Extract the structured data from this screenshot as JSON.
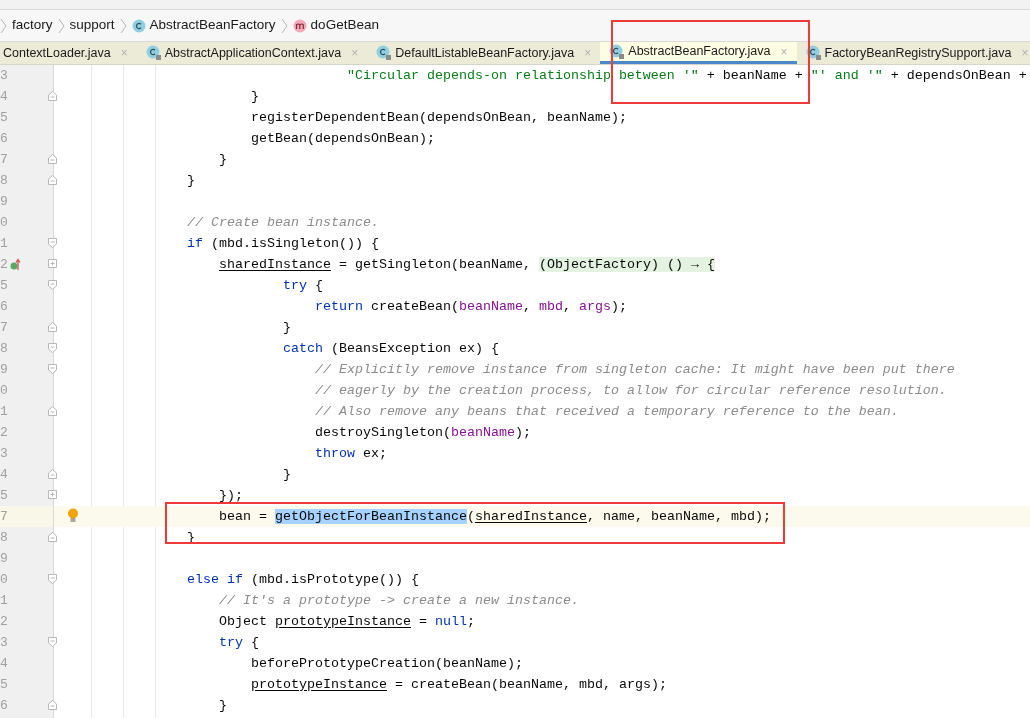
{
  "breadcrumbs": [
    {
      "label": "factory",
      "kind": "package"
    },
    {
      "label": "support",
      "kind": "package"
    },
    {
      "label": "AbstractBeanFactory",
      "kind": "class"
    },
    {
      "label": "doGetBean",
      "kind": "method"
    }
  ],
  "tabs": [
    {
      "label": "ContextLoader.java",
      "close": "×",
      "icon": false,
      "selected": false,
      "annotated": false
    },
    {
      "label": "AbstractApplicationContext.java",
      "close": "×",
      "icon": true,
      "selected": false,
      "annotated": false
    },
    {
      "label": "DefaultListableBeanFactory.java",
      "close": "×",
      "icon": true,
      "selected": false,
      "annotated": false
    },
    {
      "label": "AbstractBeanFactory.java",
      "close": "×",
      "icon": true,
      "selected": true,
      "annotated": true
    },
    {
      "label": "FactoryBeanRegistrySupport.java",
      "close": "×",
      "icon": true,
      "selected": false,
      "annotated": false
    }
  ],
  "editor": {
    "lines": [
      {
        "number": "3",
        "kind": "plain",
        "segments": [
          {
            "text": "                                    \"Circular depends-on relationship between '\"",
            "kind": "string"
          },
          {
            "text": " + beanName + ",
            "kind": "plain"
          },
          {
            "text": "\"' and '\"",
            "kind": "string"
          },
          {
            "text": " + dependsOnBean +",
            "kind": "plain"
          }
        ]
      },
      {
        "number": "4",
        "kind": "fold_end",
        "segments": [
          {
            "text": "                        }",
            "kind": "plain"
          }
        ]
      },
      {
        "number": "5",
        "kind": "plain",
        "segments": [
          {
            "text": "                        registerDependentBean(dependsOnBean, beanName);",
            "kind": "plain"
          }
        ]
      },
      {
        "number": "6",
        "kind": "plain",
        "segments": [
          {
            "text": "                        getBean(dependsOnBean);",
            "kind": "plain"
          }
        ]
      },
      {
        "number": "7",
        "kind": "fold_end",
        "segments": [
          {
            "text": "                    }",
            "kind": "plain"
          }
        ]
      },
      {
        "number": "8",
        "kind": "fold_end",
        "segments": [
          {
            "text": "                }",
            "kind": "plain"
          }
        ]
      },
      {
        "number": "9",
        "kind": "plain"
      },
      {
        "number": "0",
        "kind": "plain",
        "segments": [
          {
            "text": "                // Create bean instance.",
            "kind": "comment"
          }
        ]
      },
      {
        "number": "1",
        "kind": "fold_start",
        "segments": [
          {
            "text": "                if",
            "kind": "keyword"
          },
          {
            "text": " (mbd.isSingleton()) {",
            "kind": "plain"
          }
        ]
      },
      {
        "number": "2",
        "kind": "collapsed",
        "marker": true,
        "segments": [
          {
            "text": "                    sharedInstance",
            "kind": "field"
          },
          {
            "text": " = getSingleton(beanName, ",
            "kind": "plain"
          },
          {
            "text": "(ObjectFactory) () → {",
            "kind": "folded"
          }
        ]
      },
      {
        "number": "5",
        "kind": "fold_start",
        "segments": [
          {
            "text": "                            try",
            "kind": "keyword"
          },
          {
            "text": " {",
            "kind": "plain"
          }
        ]
      },
      {
        "number": "6",
        "kind": "plain",
        "segments": [
          {
            "text": "                                return",
            "kind": "keyword"
          },
          {
            "text": " createBean(",
            "kind": "plain"
          },
          {
            "text": "beanName",
            "kind": "param"
          },
          {
            "text": ", ",
            "kind": "plain"
          },
          {
            "text": "mbd",
            "kind": "param"
          },
          {
            "text": ", ",
            "kind": "plain"
          },
          {
            "text": "args",
            "kind": "param"
          },
          {
            "text": ");",
            "kind": "plain"
          }
        ]
      },
      {
        "number": "7",
        "kind": "fold_end",
        "segments": [
          {
            "text": "                            }",
            "kind": "plain"
          }
        ]
      },
      {
        "number": "8",
        "kind": "fold_start",
        "segments": [
          {
            "text": "                            catch",
            "kind": "keyword"
          },
          {
            "text": " (BeansException ex) {",
            "kind": "plain"
          }
        ]
      },
      {
        "number": "9",
        "kind": "fold_start",
        "segments": [
          {
            "text": "                                // Explicitly remove instance from singleton cache: It might have been put there",
            "kind": "comment"
          }
        ]
      },
      {
        "number": "0",
        "kind": "plain",
        "segments": [
          {
            "text": "                                // eagerly by the creation process, to allow for circular reference resolution.",
            "kind": "comment"
          }
        ]
      },
      {
        "number": "1",
        "kind": "fold_end",
        "segments": [
          {
            "text": "                                // Also remove any beans that received a temporary reference to the bean.",
            "kind": "comment"
          }
        ]
      },
      {
        "number": "2",
        "kind": "plain",
        "segments": [
          {
            "text": "                                destroySingleton(",
            "kind": "plain"
          },
          {
            "text": "beanName",
            "kind": "param"
          },
          {
            "text": ");",
            "kind": "plain"
          }
        ]
      },
      {
        "number": "3",
        "kind": "plain",
        "segments": [
          {
            "text": "                                throw",
            "kind": "keyword"
          },
          {
            "text": " ex;",
            "kind": "plain"
          }
        ]
      },
      {
        "number": "4",
        "kind": "fold_end",
        "segments": [
          {
            "text": "                            }",
            "kind": "plain"
          }
        ]
      },
      {
        "number": "5",
        "kind": "collapsed",
        "segments": [
          {
            "text": "                    });",
            "kind": "plain"
          }
        ]
      },
      {
        "number": "7",
        "kind": "plain",
        "current": true,
        "bulb": true,
        "annotated": true,
        "segments": [
          {
            "text": "                    bean = ",
            "kind": "plain"
          },
          {
            "text": "getObjectForBeanInstance",
            "kind": "selection"
          },
          {
            "text": "(",
            "kind": "plain"
          },
          {
            "text": "sharedInstance",
            "kind": "field"
          },
          {
            "text": ", name, beanName, mbd);",
            "kind": "plain"
          }
        ]
      },
      {
        "number": "8",
        "kind": "fold_end",
        "segments": [
          {
            "text": "                }",
            "kind": "plain"
          }
        ]
      },
      {
        "number": "9",
        "kind": "plain"
      },
      {
        "number": "0",
        "kind": "fold_start",
        "segments": [
          {
            "text": "                else if",
            "kind": "keyword"
          },
          {
            "text": " (mbd.isPrototype()) {",
            "kind": "plain"
          }
        ]
      },
      {
        "number": "1",
        "kind": "plain",
        "segments": [
          {
            "text": "                    // It's a prototype -> create a new instance.",
            "kind": "comment"
          }
        ]
      },
      {
        "number": "2",
        "kind": "plain",
        "segments": [
          {
            "text": "                    Object ",
            "kind": "plain"
          },
          {
            "text": "prototypeInstance",
            "kind": "field"
          },
          {
            "text": " = ",
            "kind": "plain"
          },
          {
            "text": "null",
            "kind": "keyword"
          },
          {
            "text": ";",
            "kind": "plain"
          }
        ]
      },
      {
        "number": "3",
        "kind": "fold_start",
        "segments": [
          {
            "text": "                    try",
            "kind": "keyword"
          },
          {
            "text": " {",
            "kind": "plain"
          }
        ]
      },
      {
        "number": "4",
        "kind": "plain",
        "segments": [
          {
            "text": "                        beforePrototypeCreation(beanName);",
            "kind": "plain"
          }
        ]
      },
      {
        "number": "5",
        "kind": "plain",
        "segments": [
          {
            "text": "                        prototypeInstance",
            "kind": "field"
          },
          {
            "text": " = createBean(beanName, mbd, args);",
            "kind": "plain"
          }
        ]
      },
      {
        "number": "6",
        "kind": "fold_end",
        "segments": [
          {
            "text": "                    }",
            "kind": "plain"
          }
        ]
      }
    ]
  }
}
